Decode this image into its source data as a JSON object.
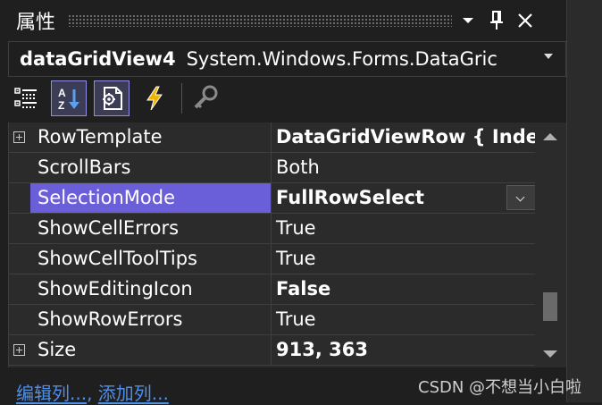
{
  "window": {
    "title": "属性",
    "buttons": [
      "dropdown-arrow",
      "pin",
      "close"
    ]
  },
  "object_selector": {
    "name": "dataGridView4",
    "type": "System.Windows.Forms.DataGric"
  },
  "toolbar": {
    "buttons": [
      {
        "icon": "categorized-icon",
        "active": false
      },
      {
        "icon": "alphabetical-icon",
        "active": true
      },
      {
        "icon": "properties-icon",
        "active": true
      },
      {
        "icon": "events-icon",
        "active": false
      },
      {
        "icon": "property-pages-icon",
        "active": false
      }
    ]
  },
  "properties": [
    {
      "name": "RowTemplate",
      "value": "DataGridViewRow { Inde",
      "bold": true,
      "expandable": true
    },
    {
      "name": "ScrollBars",
      "value": "Both",
      "bold": false,
      "expandable": false
    },
    {
      "name": "SelectionMode",
      "value": "FullRowSelect",
      "bold": true,
      "expandable": false,
      "selected": true
    },
    {
      "name": "ShowCellErrors",
      "value": "True",
      "bold": false,
      "expandable": false
    },
    {
      "name": "ShowCellToolTips",
      "value": "True",
      "bold": false,
      "expandable": false
    },
    {
      "name": "ShowEditingIcon",
      "value": "False",
      "bold": true,
      "expandable": false
    },
    {
      "name": "ShowRowErrors",
      "value": "True",
      "bold": false,
      "expandable": false
    },
    {
      "name": "Size",
      "value": "913, 363",
      "bold": true,
      "expandable": true
    }
  ],
  "scrollbar": {
    "position": 0.72
  },
  "commands": {
    "edit_columns": "编辑列...",
    "separator": ", ",
    "add_column": "添加列..."
  },
  "watermark": "CSDN @不想当小白啦",
  "colors": {
    "background": "#1f1f1f",
    "grid_background": "#2b2b2b",
    "selection": "#6b5ed9",
    "link": "#4f8fe8",
    "active_button_border": "#8f8fe6"
  }
}
